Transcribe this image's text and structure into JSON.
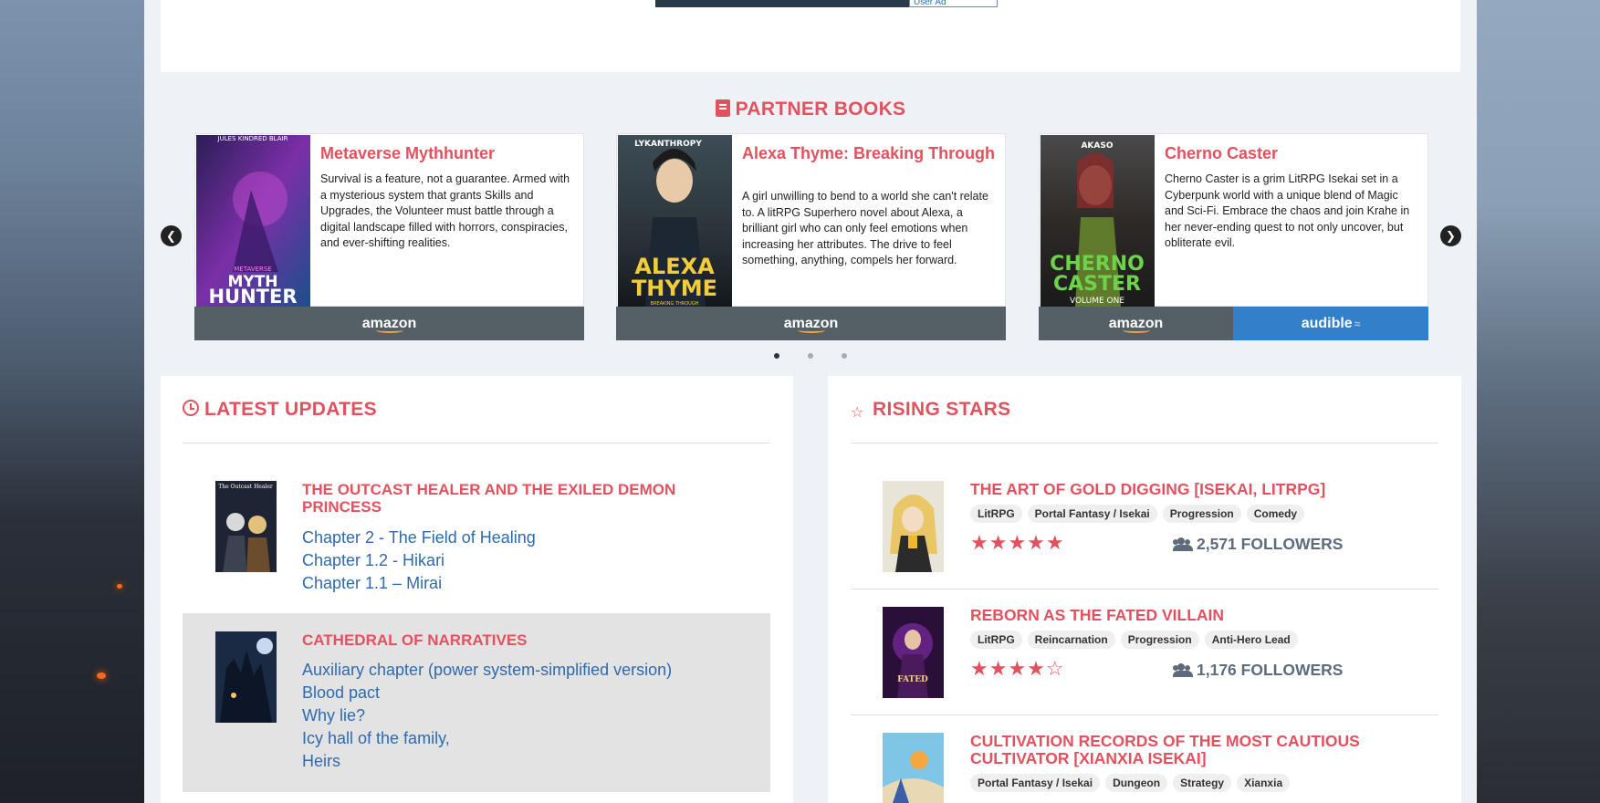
{
  "ad": {
    "tag_text": "User Ad"
  },
  "partner_books": {
    "title": "PARTNER BOOKS",
    "prev_glyph": "❮",
    "next_glyph": "❯",
    "books": [
      {
        "title": "Metaverse Mythhunter",
        "description": "Survival is a feature, not a guarantee. Armed with a mysterious system that grants Skills and Upgrades, the Volunteer must battle through a digital landscape filled with horrors, conspiracies, and ever-shifting realities.",
        "cover_author": "JULES KINDRED BLAIR",
        "cover_series": "METAVERSE",
        "cover_title_1": "MYTH",
        "cover_title_2": "HUNTER",
        "store": "amazon"
      },
      {
        "title": "Alexa Thyme: Breaking Through",
        "description": "A girl unwilling to bend to a world she can't relate to. A litRPG Superhero novel about Alexa, a brilliant girl who can only feel emotions when increasing her attributes. The drive to feel something, anything, compels her forward.",
        "cover_author": "LYKANTHROPY",
        "cover_title_1": "ALEXA",
        "cover_title_2": "THYME",
        "cover_subtitle": "BREAKING THROUGH",
        "store": "amazon"
      },
      {
        "title": "Cherno Caster",
        "description": "Cherno Caster is a grim LitRPG Isekai set in a Cyberpunk world with a unique blend of Magic and Sci-Fi. Embrace the chaos and join Krahe in her never-ending quest to not only uncover, but obliterate evil.",
        "cover_author": "AKASO",
        "cover_title_1": "CHERNO",
        "cover_title_2": "CASTER",
        "cover_subtitle": "VOLUME ONE",
        "store": "amazon",
        "store2": "audible"
      }
    ]
  },
  "latest_updates": {
    "title": "LATEST UPDATES",
    "items": [
      {
        "title": "THE OUTCAST HEALER AND THE EXILED DEMON PRINCESS",
        "cover_text": "The Outcast Healer",
        "chapters": [
          "Chapter 2 - The Field of Healing",
          "Chapter 1.2 - Hikari",
          "Chapter 1.1 – Mirai"
        ]
      },
      {
        "title": "CATHEDRAL OF NARRATIVES",
        "chapters": [
          "Auxiliary chapter (power system-simplified version)",
          "Blood pact",
          "Why lie?",
          "Icy hall of the family,",
          "Heirs"
        ]
      }
    ]
  },
  "rising_stars": {
    "title": "RISING STARS",
    "items": [
      {
        "title": "THE ART OF GOLD DIGGING [ISEKAI, LITRPG]",
        "tags": [
          "LitRPG",
          "Portal Fantasy / Isekai",
          "Progression",
          "Comedy"
        ],
        "rating": 5,
        "stars": "★★★★★",
        "followers": "2,571 FOLLOWERS"
      },
      {
        "title": "REBORN AS THE FATED VILLAIN",
        "tags": [
          "LitRPG",
          "Reincarnation",
          "Progression",
          "Anti-Hero Lead"
        ],
        "rating": 4,
        "stars": "★★★★☆",
        "followers": "1,176 FOLLOWERS"
      },
      {
        "title": "CULTIVATION RECORDS OF THE MOST CAUTIOUS CULTIVATOR [XIANXIA ISEKAI]",
        "tags": [
          "Portal Fantasy / Isekai",
          "Dungeon",
          "Strategy",
          "Xianxia"
        ]
      }
    ]
  },
  "colors": {
    "accent": "#e0525f",
    "link": "#2e6aad",
    "amazon_bar": "#555f66",
    "audible_bar": "#3480c8"
  }
}
